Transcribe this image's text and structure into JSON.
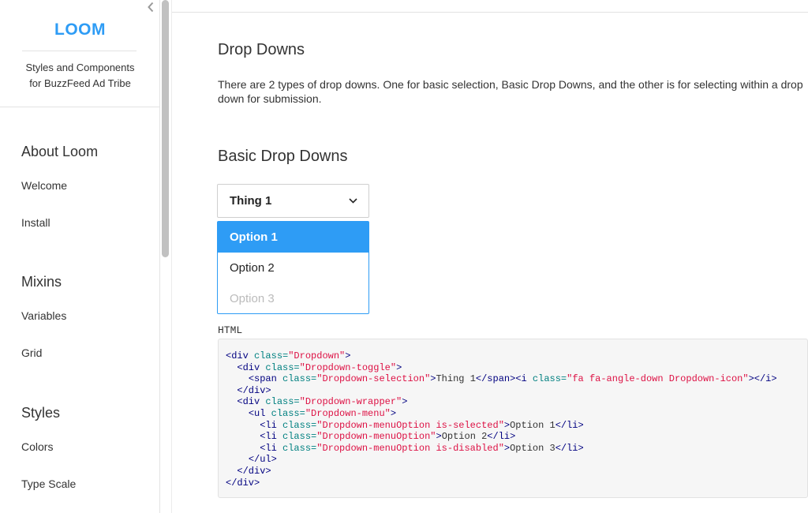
{
  "sidebar": {
    "brand": "LOOM",
    "tagline_line1": "Styles and Components",
    "tagline_line2": "for BuzzFeed Ad Tribe",
    "sections": [
      {
        "title": "About Loom",
        "items": [
          "Welcome",
          "Install"
        ]
      },
      {
        "title": "Mixins",
        "items": [
          "Variables",
          "Grid"
        ]
      },
      {
        "title": "Styles",
        "items": [
          "Colors",
          "Type Scale"
        ]
      }
    ]
  },
  "main": {
    "title": "Drop Downs",
    "description": "There are 2 types of drop downs. One for basic selection, Basic Drop Downs, and the other is for selecting within a drop down for submission.",
    "subtitle": "Basic Drop Downs",
    "dropdown": {
      "selected": "Thing 1",
      "options": [
        {
          "label": "Option 1",
          "state": "selected"
        },
        {
          "label": "Option 2",
          "state": "normal"
        },
        {
          "label": "Option 3",
          "state": "disabled"
        }
      ]
    },
    "code_label": "HTML",
    "code": [
      [
        [
          "t",
          "<div "
        ],
        [
          "a",
          "class="
        ],
        [
          "s",
          "\"Dropdown\""
        ],
        [
          "t",
          ">"
        ]
      ],
      [
        [
          "x",
          "  "
        ],
        [
          "t",
          "<div "
        ],
        [
          "a",
          "class="
        ],
        [
          "s",
          "\"Dropdown-toggle\""
        ],
        [
          "t",
          ">"
        ]
      ],
      [
        [
          "x",
          "    "
        ],
        [
          "t",
          "<span "
        ],
        [
          "a",
          "class="
        ],
        [
          "s",
          "\"Dropdown-selection\""
        ],
        [
          "t",
          ">"
        ],
        [
          "x",
          "Thing 1"
        ],
        [
          "t",
          "</span><i "
        ],
        [
          "a",
          "class="
        ],
        [
          "s",
          "\"fa fa-angle-down Dropdown-icon\""
        ],
        [
          "t",
          "></i>"
        ]
      ],
      [
        [
          "x",
          "  "
        ],
        [
          "t",
          "</div>"
        ]
      ],
      [
        [
          "x",
          "  "
        ],
        [
          "t",
          "<div "
        ],
        [
          "a",
          "class="
        ],
        [
          "s",
          "\"Dropdown-wrapper\""
        ],
        [
          "t",
          ">"
        ]
      ],
      [
        [
          "x",
          "    "
        ],
        [
          "t",
          "<ul "
        ],
        [
          "a",
          "class="
        ],
        [
          "s",
          "\"Dropdown-menu\""
        ],
        [
          "t",
          ">"
        ]
      ],
      [
        [
          "x",
          "      "
        ],
        [
          "t",
          "<li "
        ],
        [
          "a",
          "class="
        ],
        [
          "s",
          "\"Dropdown-menuOption is-selected\""
        ],
        [
          "t",
          ">"
        ],
        [
          "x",
          "Option 1"
        ],
        [
          "t",
          "</li>"
        ]
      ],
      [
        [
          "x",
          "      "
        ],
        [
          "t",
          "<li "
        ],
        [
          "a",
          "class="
        ],
        [
          "s",
          "\"Dropdown-menuOption\""
        ],
        [
          "t",
          ">"
        ],
        [
          "x",
          "Option 2"
        ],
        [
          "t",
          "</li>"
        ]
      ],
      [
        [
          "x",
          "      "
        ],
        [
          "t",
          "<li "
        ],
        [
          "a",
          "class="
        ],
        [
          "s",
          "\"Dropdown-menuOption is-disabled\""
        ],
        [
          "t",
          ">"
        ],
        [
          "x",
          "Option 3"
        ],
        [
          "t",
          "</li>"
        ]
      ],
      [
        [
          "x",
          "    "
        ],
        [
          "t",
          "</ul>"
        ]
      ],
      [
        [
          "x",
          "  "
        ],
        [
          "t",
          "</div>"
        ]
      ],
      [
        [
          "t",
          "</div>"
        ]
      ]
    ]
  },
  "colors": {
    "accent": "#2e9cf5",
    "code_tag": "#000080",
    "code_attr": "#008080",
    "code_string": "#dd1144"
  },
  "icons": {
    "collapse": "chevron-left-icon",
    "dropdown": "chevron-down-icon"
  }
}
